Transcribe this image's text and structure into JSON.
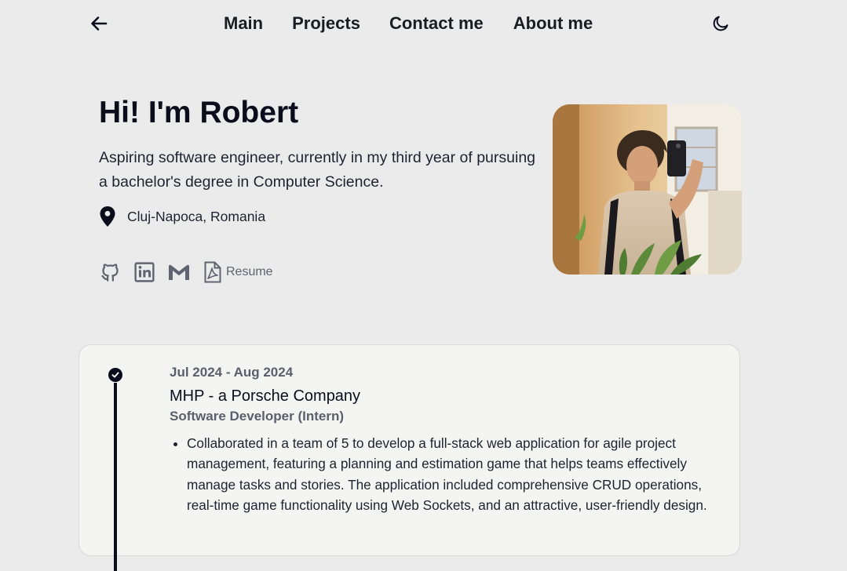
{
  "nav": {
    "back_icon": "arrow-left-icon",
    "links": [
      "Main",
      "Projects",
      "Contact me",
      "About me"
    ],
    "theme_icon": "moon-icon"
  },
  "hero": {
    "title": "Hi! I'm Robert",
    "subtitle": "Aspiring software engineer, currently in my third year of pursuing a bachelor's degree in Computer Science.",
    "location": "Cluj-Napoca, Romania",
    "location_icon": "map-pin-icon",
    "socials": [
      {
        "icon": "github-icon"
      },
      {
        "icon": "linkedin-icon"
      },
      {
        "icon": "gmail-icon"
      }
    ],
    "resume_label": "Resume",
    "resume_icon": "pdf-file-icon",
    "avatar": "profile-photo"
  },
  "experience": [
    {
      "dates": "Jul 2024 - Aug 2024",
      "company": "MHP - a Porsche Company",
      "role": "Software Developer (Intern)",
      "bullets": [
        "Collaborated in a team of 5 to develop a full-stack web application for agile project management, featuring a planning and estimation game that helps teams effectively manage tasks and stories. The application included comprehensive CRUD operations, real-time game functionality using Web Sockets, and an attractive, user-friendly design."
      ]
    }
  ],
  "colors": {
    "background": "#ebebec",
    "card": "#f4f4f2",
    "text": "#0b0d1c",
    "muted": "#5a5f6b"
  }
}
